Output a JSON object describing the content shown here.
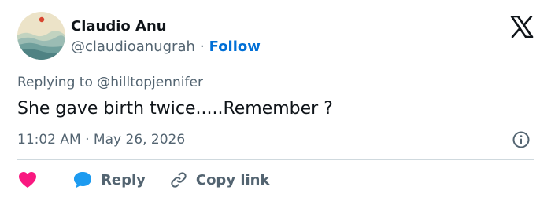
{
  "author": {
    "display_name": "Claudio Anu",
    "handle": "@claudioanugrah",
    "separator": "·",
    "follow_label": "Follow"
  },
  "reply_context": {
    "prefix": "Replying to",
    "mention": "@hilltopjennifer"
  },
  "tweet": {
    "text": "She gave birth twice.....Remember ?",
    "time": "11:02 AM",
    "separator": "·",
    "date": "May 26, 2026"
  },
  "actions": {
    "reply_label": "Reply",
    "copy_link_label": "Copy link"
  },
  "icons": {
    "logo": "x-logo-icon",
    "info": "info-icon",
    "like": "heart-icon",
    "reply": "speech-bubble-icon",
    "copy_link": "link-icon"
  },
  "colors": {
    "follow": "#006fd6",
    "heart": "#f91880",
    "reply_bubble": "#1d9bf0",
    "muted_text": "#536471",
    "divider": "#cfd9de"
  }
}
